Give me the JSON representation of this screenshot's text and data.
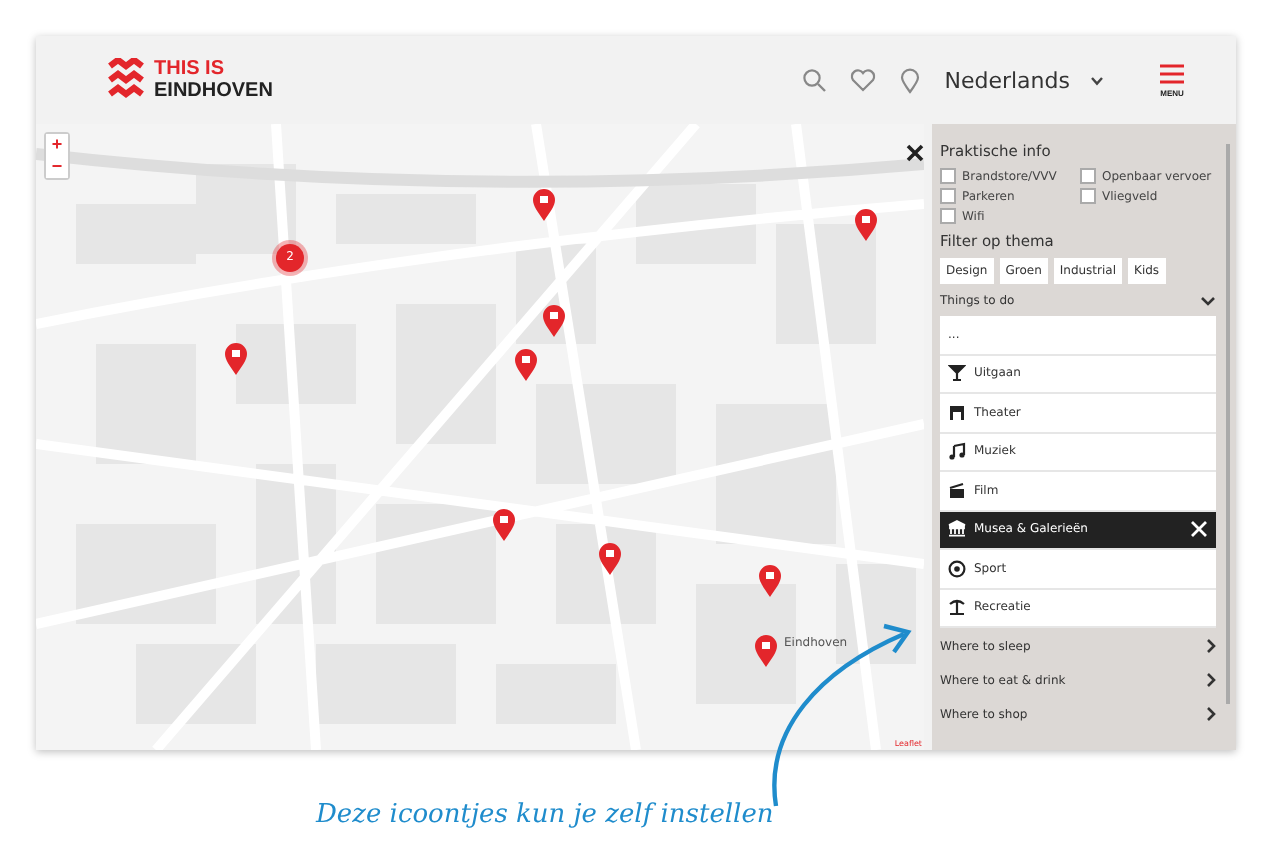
{
  "header": {
    "logo_line_1": "THIS IS",
    "logo_line_2": "EINDHOVEN",
    "language": "Nederlands",
    "menu_label": "MENU"
  },
  "map": {
    "zoom_in": "+",
    "zoom_out": "−",
    "cluster_count": "2",
    "place_label": "Eindhoven",
    "attribution": "Leaflet"
  },
  "sidebar": {
    "practical_title": "Praktische info",
    "checkboxes": [
      {
        "label": "Brandstore/VVV",
        "checked": false
      },
      {
        "label": "Openbaar vervoer",
        "checked": false
      },
      {
        "label": "Parkeren",
        "checked": false
      },
      {
        "label": "Vliegveld",
        "checked": false
      },
      {
        "label": "Wifi",
        "checked": false
      }
    ],
    "theme_title": "Filter op thema",
    "themes": [
      "Design",
      "Groen",
      "Industrial",
      "Kids"
    ],
    "sections": [
      {
        "label": "Things to do",
        "expanded": true,
        "items": [
          {
            "label": "...",
            "kind": "more",
            "selected": false
          },
          {
            "label": "Uitgaan",
            "kind": "nightlife",
            "selected": false
          },
          {
            "label": "Theater",
            "kind": "theater",
            "selected": false
          },
          {
            "label": "Muziek",
            "kind": "music",
            "selected": false
          },
          {
            "label": "Film",
            "kind": "film",
            "selected": false
          },
          {
            "label": "Musea & Galerieën",
            "kind": "museum",
            "selected": true
          },
          {
            "label": "Sport",
            "kind": "sport",
            "selected": false
          },
          {
            "label": "Recreatie",
            "kind": "recreation",
            "selected": false
          }
        ]
      },
      {
        "label": "Where to sleep",
        "expanded": false
      },
      {
        "label": "Where to eat & drink",
        "expanded": false
      },
      {
        "label": "Where to shop",
        "expanded": false
      }
    ]
  },
  "annotation": "Deze icoontjes kun je zelf instellen"
}
